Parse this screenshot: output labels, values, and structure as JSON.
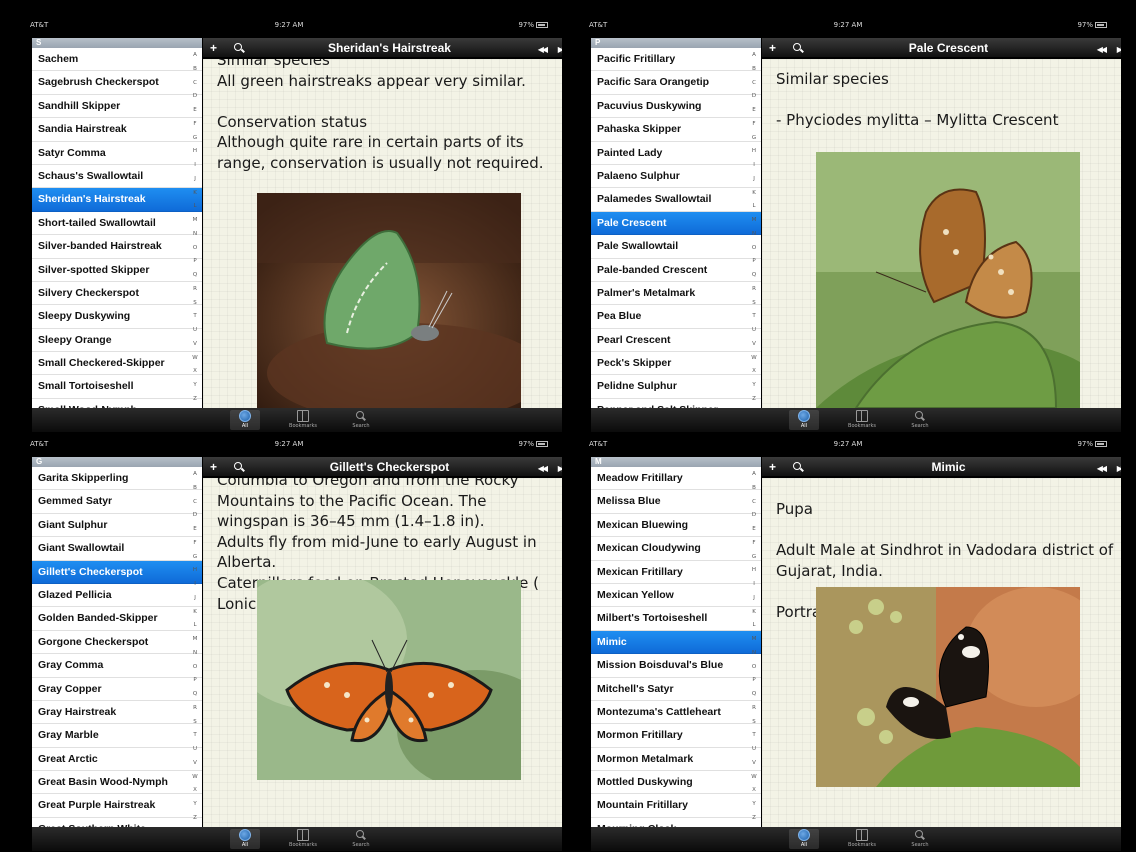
{
  "panels": [
    {
      "status": {
        "carrier": "AT&T",
        "time": "9:27 AM",
        "battery": "97%"
      },
      "sidebar": {
        "section": "S",
        "items": [
          {
            "label": "Sachem"
          },
          {
            "label": "Sagebrush Checkerspot"
          },
          {
            "label": "Sandhill Skipper"
          },
          {
            "label": "Sandia Hairstreak"
          },
          {
            "label": "Satyr Comma"
          },
          {
            "label": "Schaus's Swallowtail"
          },
          {
            "label": "Sheridan's Hairstreak"
          },
          {
            "label": "Short-tailed Swallowtail"
          },
          {
            "label": "Silver-banded Hairstreak"
          },
          {
            "label": "Silver-spotted Skipper"
          },
          {
            "label": "Silvery Checkerspot"
          },
          {
            "label": "Sleepy Duskywing"
          },
          {
            "label": "Sleepy Orange"
          },
          {
            "label": "Small Checkered-Skipper"
          },
          {
            "label": "Small Tortoiseshell"
          },
          {
            "label": "Small Wood-Nymph"
          }
        ],
        "selected_index": 6
      },
      "navbar": {
        "title": "Sheridan's Hairstreak"
      },
      "content": {
        "text": "Similar species\nAll green hairstreaks appear very similar.\n\nConservation status\nAlthough quite rare in certain parts of its range, conservation is usually not required.",
        "photo": "hairstreak"
      }
    },
    {
      "status": {
        "carrier": "AT&T",
        "time": "9:27 AM",
        "battery": "97%"
      },
      "sidebar": {
        "section": "P",
        "items": [
          {
            "label": "Pacific Fritillary"
          },
          {
            "label": "Pacific Sara Orangetip"
          },
          {
            "label": "Pacuvius Duskywing"
          },
          {
            "label": "Pahaska Skipper"
          },
          {
            "label": "Painted Lady"
          },
          {
            "label": "Palaeno Sulphur"
          },
          {
            "label": "Palamedes Swallowtail"
          },
          {
            "label": "Pale Crescent"
          },
          {
            "label": "Pale Swallowtail"
          },
          {
            "label": "Pale-banded Crescent"
          },
          {
            "label": "Palmer's Metalmark"
          },
          {
            "label": "Pea Blue"
          },
          {
            "label": "Pearl Crescent"
          },
          {
            "label": "Peck's Skipper"
          },
          {
            "label": "Pelidne Sulphur"
          },
          {
            "label": "Pepper and Salt Skipper"
          }
        ],
        "selected_index": 7
      },
      "navbar": {
        "title": "Pale Crescent"
      },
      "content": {
        "text": "Similar species\n\n- Phyciodes mylitta – Mylitta Crescent",
        "photo": "crescent"
      }
    },
    {
      "status": {
        "carrier": "AT&T",
        "time": "9:27 AM",
        "battery": "97%"
      },
      "sidebar": {
        "section": "G",
        "items": [
          {
            "label": "Garita Skipperling"
          },
          {
            "label": "Gemmed Satyr"
          },
          {
            "label": "Giant Sulphur"
          },
          {
            "label": "Giant Swallowtail"
          },
          {
            "label": "Gillett's Checkerspot"
          },
          {
            "label": "Glazed Pellicia"
          },
          {
            "label": "Golden Banded-Skipper"
          },
          {
            "label": "Gorgone Checkerspot"
          },
          {
            "label": "Gray Comma"
          },
          {
            "label": "Gray Copper"
          },
          {
            "label": "Gray Hairstreak"
          },
          {
            "label": "Gray Marble"
          },
          {
            "label": "Great Arctic"
          },
          {
            "label": "Great Basin Wood-Nymph"
          },
          {
            "label": "Great Purple Hairstreak"
          },
          {
            "label": "Great Southern White"
          }
        ],
        "selected_index": 4
      },
      "navbar": {
        "title": "Gillett's Checkerspot"
      },
      "content": {
        "text": "Columbia to Oregon and from the Rocky Mountains to the Pacific Ocean. The wingspan is 36–45 mm (1.4–1.8 in).\nAdults fly from mid-June to early August in Alberta.\nCaterpillars feed on Bracted Honeysuckle ( Lonicera involucrata ).",
        "photo": "checkerspot"
      }
    },
    {
      "status": {
        "carrier": "AT&T",
        "time": "9:27 AM",
        "battery": "97%"
      },
      "sidebar": {
        "section": "M",
        "items": [
          {
            "label": "Meadow Fritillary"
          },
          {
            "label": "Melissa Blue"
          },
          {
            "label": "Mexican Bluewing"
          },
          {
            "label": "Mexican Cloudywing"
          },
          {
            "label": "Mexican Fritillary"
          },
          {
            "label": "Mexican Yellow"
          },
          {
            "label": "Milbert's Tortoiseshell"
          },
          {
            "label": "Mimic"
          },
          {
            "label": "Mission Boisduval's Blue"
          },
          {
            "label": "Mitchell's Satyr"
          },
          {
            "label": "Montezuma's Cattleheart"
          },
          {
            "label": "Mormon Fritillary"
          },
          {
            "label": "Mormon Metalmark"
          },
          {
            "label": "Mottled Duskywing"
          },
          {
            "label": "Mountain Fritillary"
          },
          {
            "label": "Mourning Cloak"
          }
        ],
        "selected_index": 7
      },
      "navbar": {
        "title": "Mimic"
      },
      "content": {
        "text": "Pupa\n\nAdult Male at Sindhrot in Vadodara district of Gujarat, India.\n\nPortrait of the butterfly",
        "photo": "mimic"
      }
    }
  ],
  "index_letters": [
    "A",
    "B",
    "C",
    "D",
    "E",
    "F",
    "G",
    "H",
    "I",
    "J",
    "K",
    "L",
    "M",
    "N",
    "O",
    "P",
    "Q",
    "R",
    "S",
    "T",
    "U",
    "V",
    "W",
    "X",
    "Y",
    "Z"
  ],
  "tabbar": {
    "tabs": [
      {
        "label": "All",
        "icon": "globe-icon"
      },
      {
        "label": "Bookmarks",
        "icon": "book-icon"
      },
      {
        "label": "Search",
        "icon": "search-icon"
      }
    ],
    "active_index": 0
  },
  "navbar_buttons": {
    "add": "+",
    "prev": "◀◀",
    "next": "▶▶"
  },
  "colors": {
    "selection": "#1a82ea",
    "content_bg": "#f3f3e6",
    "navbar": "#1d1d1d"
  }
}
